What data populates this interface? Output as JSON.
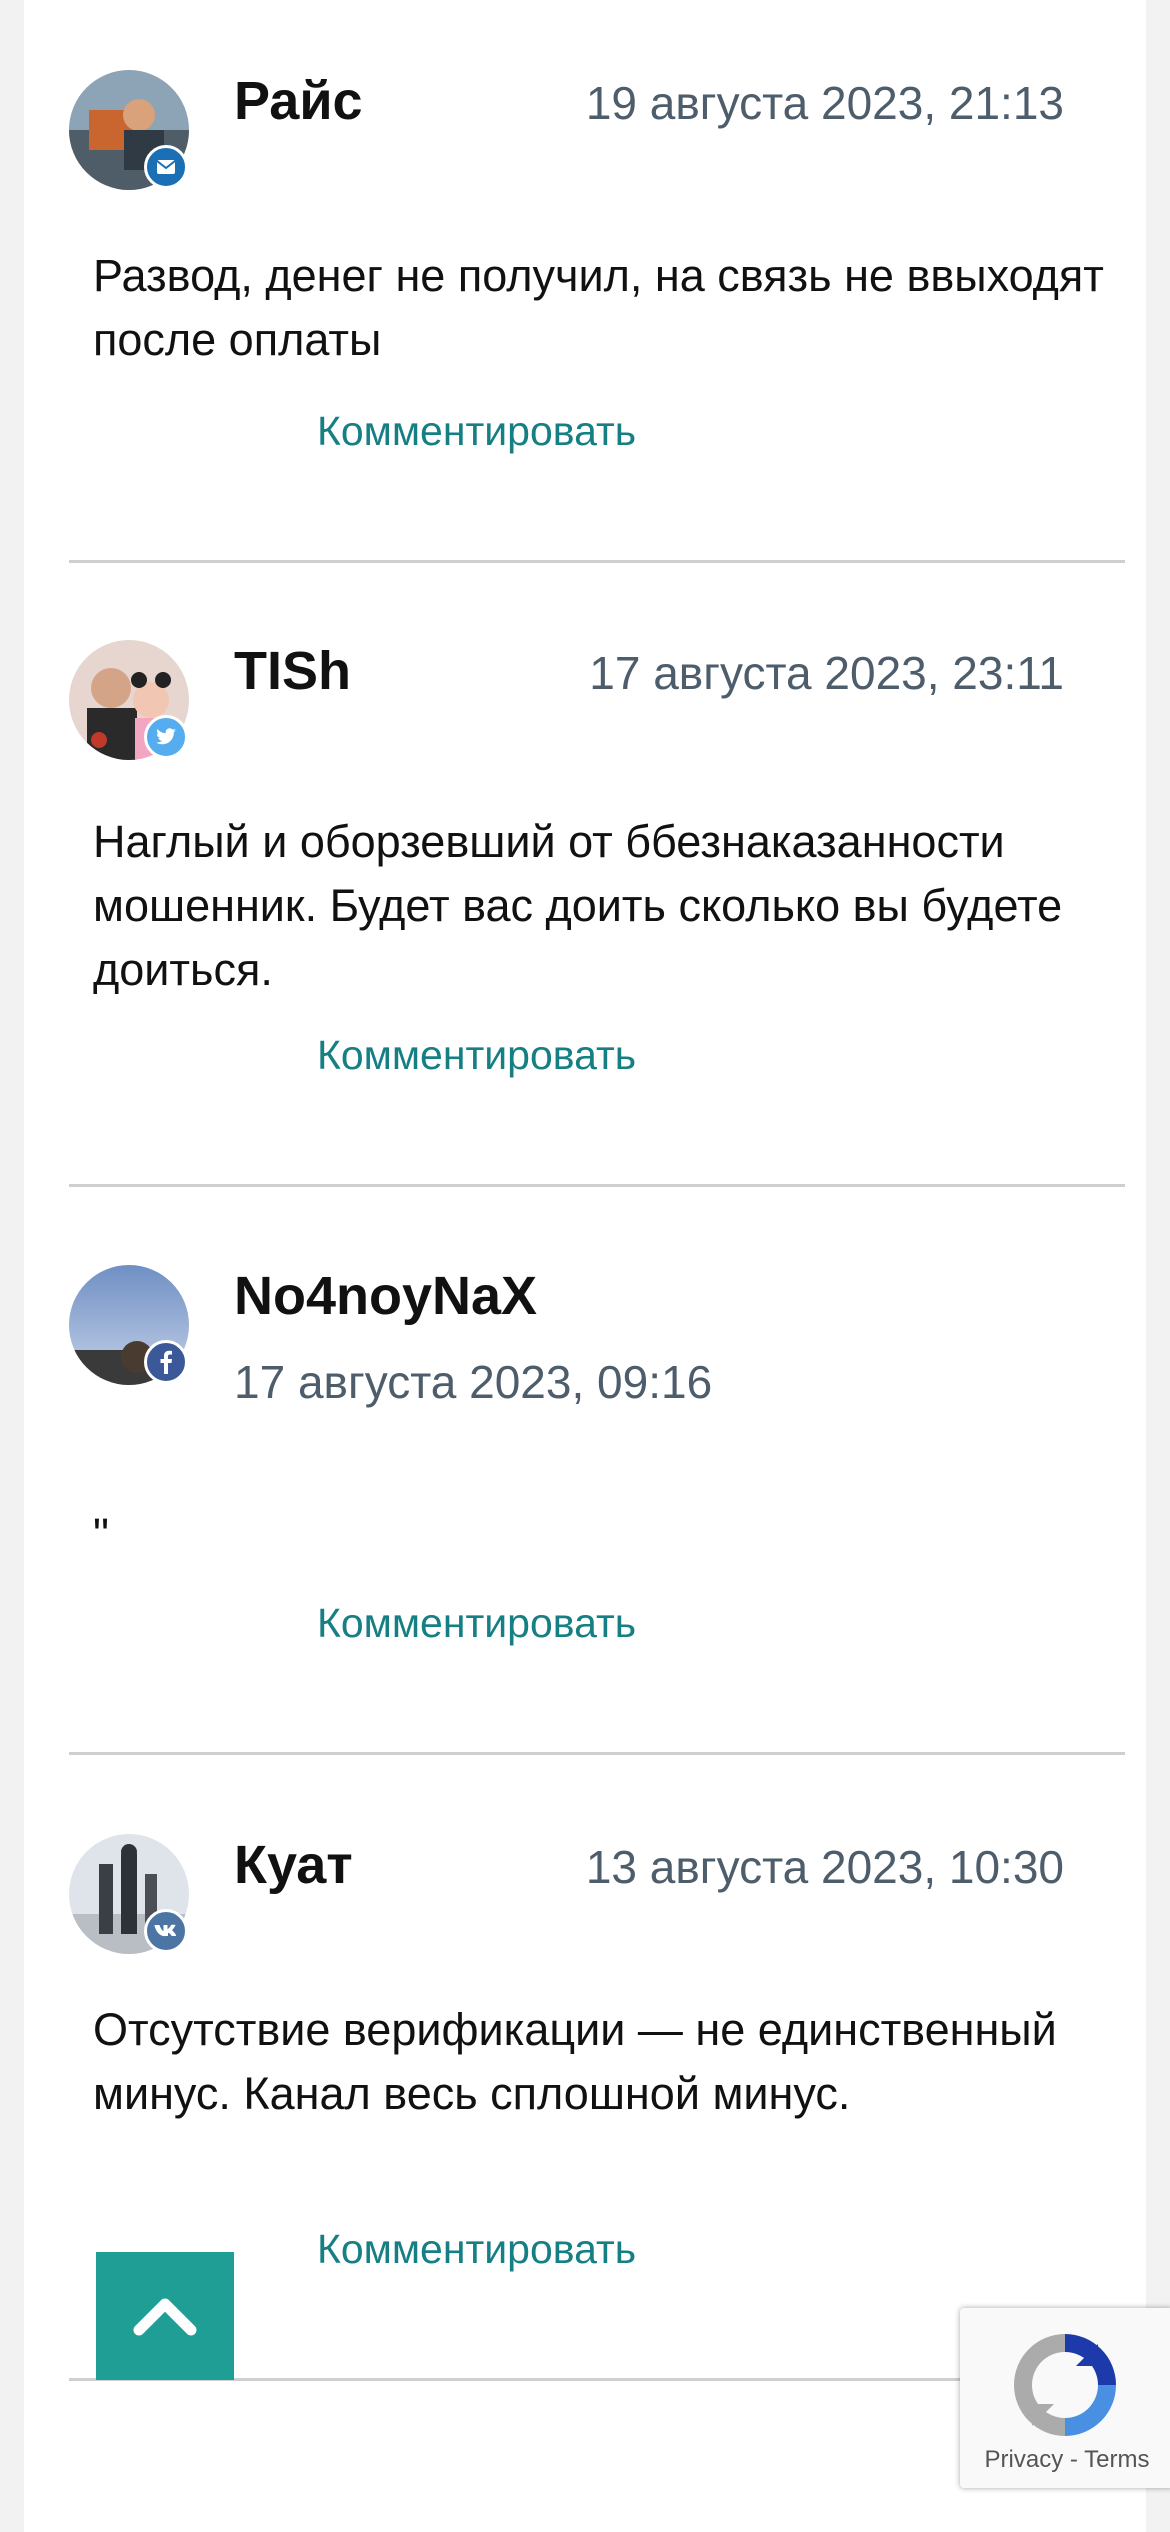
{
  "comments": [
    {
      "author": "Райс",
      "date": "19 августа 2023, 21:13",
      "text": "Развод, денег не получил, на связь не ввыходят после оплаты",
      "reply_label": "Комментировать",
      "network": "mail-icon",
      "badge_color": "#1a6fb5"
    },
    {
      "author": "TISh",
      "date": "17 августа 2023, 23:11",
      "text": "Наглый и оборзевший от ббезнаказанности мошенник. Будет вас доить сколько вы будете доиться.",
      "reply_label": "Комментировать",
      "network": "twitter-icon",
      "badge_color": "#55acee"
    },
    {
      "author": "No4noyNaX",
      "date": "17 августа 2023, 09:16",
      "text": "\"",
      "reply_label": "Комментировать",
      "network": "facebook-icon",
      "badge_color": "#3b5998"
    },
    {
      "author": "Куат",
      "date": "13 августа 2023, 10:30",
      "text": "Отсутствие верификации — не единственный минус. Канал весь сплошной минус.",
      "reply_label": "Комментировать",
      "network": "vk-icon",
      "badge_color": "#4c75a3"
    }
  ],
  "scroll_top": {
    "icon": "chevron-up-icon",
    "color": "#1e9e95"
  },
  "recaptcha": {
    "privacy": "Privacy",
    "separator": "-",
    "terms": "Terms"
  }
}
